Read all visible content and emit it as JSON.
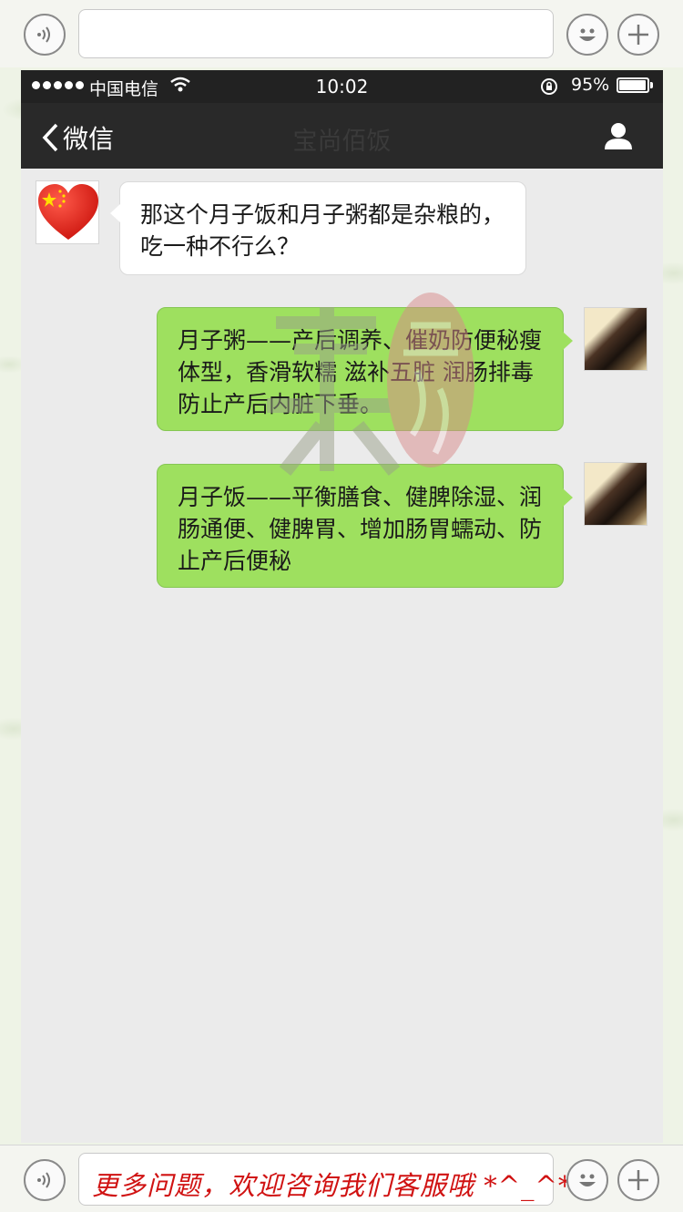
{
  "composer_top": {
    "text": ""
  },
  "composer_bottom": {
    "text": "更多问题，欢迎咨询我们客服哦 *^_^*"
  },
  "status_bar": {
    "carrier": "中国电信",
    "time": "10:02",
    "battery": "95%",
    "battery_level": 0.95
  },
  "nav": {
    "back_label": "微信",
    "title": "宝尚佰饭"
  },
  "messages": [
    {
      "side": "left",
      "text": "那这个月子饭和月子粥都是杂粮的，吃一种不行么？"
    },
    {
      "side": "right",
      "text": "月子粥——产后调养、催奶防便秘瘦体型，香滑软糯 滋补五脏 润肠排毒 防止产后内脏下垂。"
    },
    {
      "side": "right",
      "text": "月子饭——平衡膳食、健脾除湿、润肠通便、健脾胃、增加肠胃蠕动、防止产后便秘"
    }
  ],
  "colors": {
    "sent_bubble": "#9ee05f",
    "received_bubble": "#ffffff",
    "composer_text": "#d01212"
  }
}
